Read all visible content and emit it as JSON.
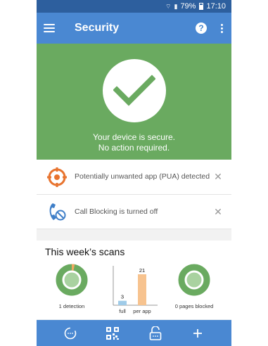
{
  "status_bar": {
    "battery": "79%",
    "time": "17:10"
  },
  "app_bar": {
    "title": "Security"
  },
  "hero": {
    "line1": "Your device is secure.",
    "line2": "No action required."
  },
  "alerts": [
    {
      "text": "Potentially unwanted app (PUA) detected",
      "icon": "target-alert-icon"
    },
    {
      "text": "Call Blocking is turned off",
      "icon": "call-blocked-icon"
    }
  ],
  "scans": {
    "title": "This week’s scans",
    "detections": {
      "label": "1 detection",
      "fraction": 0.03
    },
    "bars": [
      {
        "label": "full",
        "value": 3,
        "value_label": "3"
      },
      {
        "label": "per app",
        "value": 21,
        "value_label": "21"
      }
    ],
    "pages": {
      "label": "0 pages blocked",
      "fraction": 0
    }
  },
  "colors": {
    "accent": "#4a88d2",
    "secure": "#6aaa60",
    "warn": "#f0a860",
    "bar_full": "#9fcbe8"
  },
  "bottom_nav": [
    "scan-icon",
    "qr-code-icon",
    "app-lock-icon",
    "add-icon"
  ]
}
